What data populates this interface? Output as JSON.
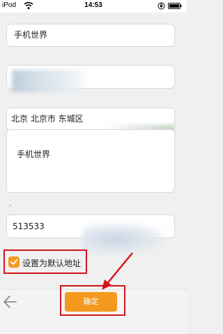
{
  "status": {
    "carrier": "iPod",
    "time": "14:53"
  },
  "form": {
    "name_value": "手机世界",
    "region_value": "北京 北京市 东城区",
    "address_value": "手机世界",
    "postcode_value": "513533",
    "default_label": "设置为默认地址"
  },
  "confirm_label": "确定",
  "icons": {
    "wifi": "wifi-icon",
    "lock": "rotation-lock-icon",
    "battery": "battery-icon",
    "back": "back-arrow-icon",
    "check": "check-icon"
  },
  "colors": {
    "accent": "#f39a1e",
    "highlight": "#d4141c"
  }
}
